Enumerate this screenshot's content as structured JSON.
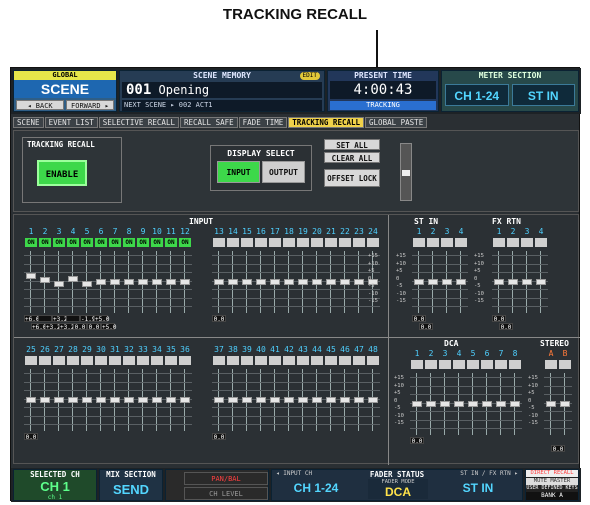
{
  "callout": "TRACKING RECALL",
  "global": {
    "title": "GLOBAL",
    "scene": "SCENE",
    "back": "◂ BACK",
    "forward": "FORWARD ▸"
  },
  "scene_memory": {
    "title": "SCENE MEMORY",
    "edit": "EDIT",
    "number": "001",
    "name": "Opening",
    "next_label": "NEXT SCENE",
    "next": "▸ 002 ACT1"
  },
  "present_time": {
    "title": "PRESENT TIME",
    "time": "4:00:43",
    "mode": "TRACKING"
  },
  "meter": {
    "title": "METER SECTION",
    "b1": "CH 1-24",
    "b2": "ST IN"
  },
  "tabs": [
    "SCENE",
    "EVENT LIST",
    "SELECTIVE RECALL",
    "RECALL SAFE",
    "FADE TIME",
    "TRACKING RECALL",
    "GLOBAL PASTE"
  ],
  "active_tab": "TRACKING RECALL",
  "tracking": {
    "label": "TRACKING RECALL",
    "enable": "ENABLE"
  },
  "display_select": {
    "label": "DISPLAY SELECT",
    "input": "INPUT",
    "output": "OUTPUT"
  },
  "actions": {
    "set_all": "SET ALL",
    "clear_all": "CLEAR ALL",
    "offset_lock": "OFFSET LOCK"
  },
  "sections": {
    "input": "INPUT",
    "st_in": "ST IN",
    "fx_rtn": "FX RTN",
    "dca": "DCA",
    "stereo": "STEREO"
  },
  "input_ch_row1": [
    "1",
    "2",
    "3",
    "4",
    "5",
    "6",
    "7",
    "8",
    "9",
    "10",
    "11",
    "12",
    "13",
    "14",
    "15",
    "16",
    "17",
    "18",
    "19",
    "20",
    "21",
    "22",
    "23",
    "24"
  ],
  "input_ch_row2": [
    "25",
    "26",
    "27",
    "28",
    "29",
    "30",
    "31",
    "32",
    "33",
    "34",
    "35",
    "36",
    "37",
    "38",
    "39",
    "40",
    "41",
    "42",
    "43",
    "44",
    "45",
    "46",
    "47",
    "48"
  ],
  "on_label": "ON",
  "st_in_ch": [
    "1",
    "2",
    "3",
    "4"
  ],
  "fx_rtn_ch": [
    "1",
    "2",
    "3",
    "4"
  ],
  "dca_ch": [
    "1",
    "2",
    "3",
    "4",
    "5",
    "6",
    "7",
    "8"
  ],
  "stereo_ch": [
    "A",
    "B"
  ],
  "scale": [
    "+15",
    "+10",
    "+5",
    "0",
    "-5",
    "-10",
    "-15"
  ],
  "input_vals_row1_top": [
    "+6.0",
    "",
    "+3.2",
    "",
    "-1.9",
    "+5.0",
    "0.0",
    "0.0",
    "0.0",
    "0.0",
    "0.0",
    "0.0"
  ],
  "input_vals_row1_bot": [
    "+6.0",
    "+3.2",
    "+3.2",
    "0.0",
    "0.0",
    "+5.0"
  ],
  "vals_zero": "0.0",
  "bottom": {
    "selected_ch_title": "SELECTED CH",
    "selected_ch": "CH 1",
    "selected_sub": "ch 1",
    "mix_title": "MIX SECTION",
    "mix": "SEND",
    "pan": "PAN/BAL",
    "ch_level": "CH LEVEL",
    "fader_status": "FADER STATUS",
    "input_ch": "◂ INPUT CH",
    "input_val": "CH 1-24",
    "fader_mode": "FADER MODE",
    "fader_mode_val": "DCA",
    "st_in_fx": "ST IN / FX RTN ▸",
    "st_in_val": "ST IN",
    "direct_recall": "DIRECT RECALL",
    "mute_master": "MUTE MASTER",
    "user_defined": "USER DEFINED KEYS",
    "bank": "BANK A"
  }
}
